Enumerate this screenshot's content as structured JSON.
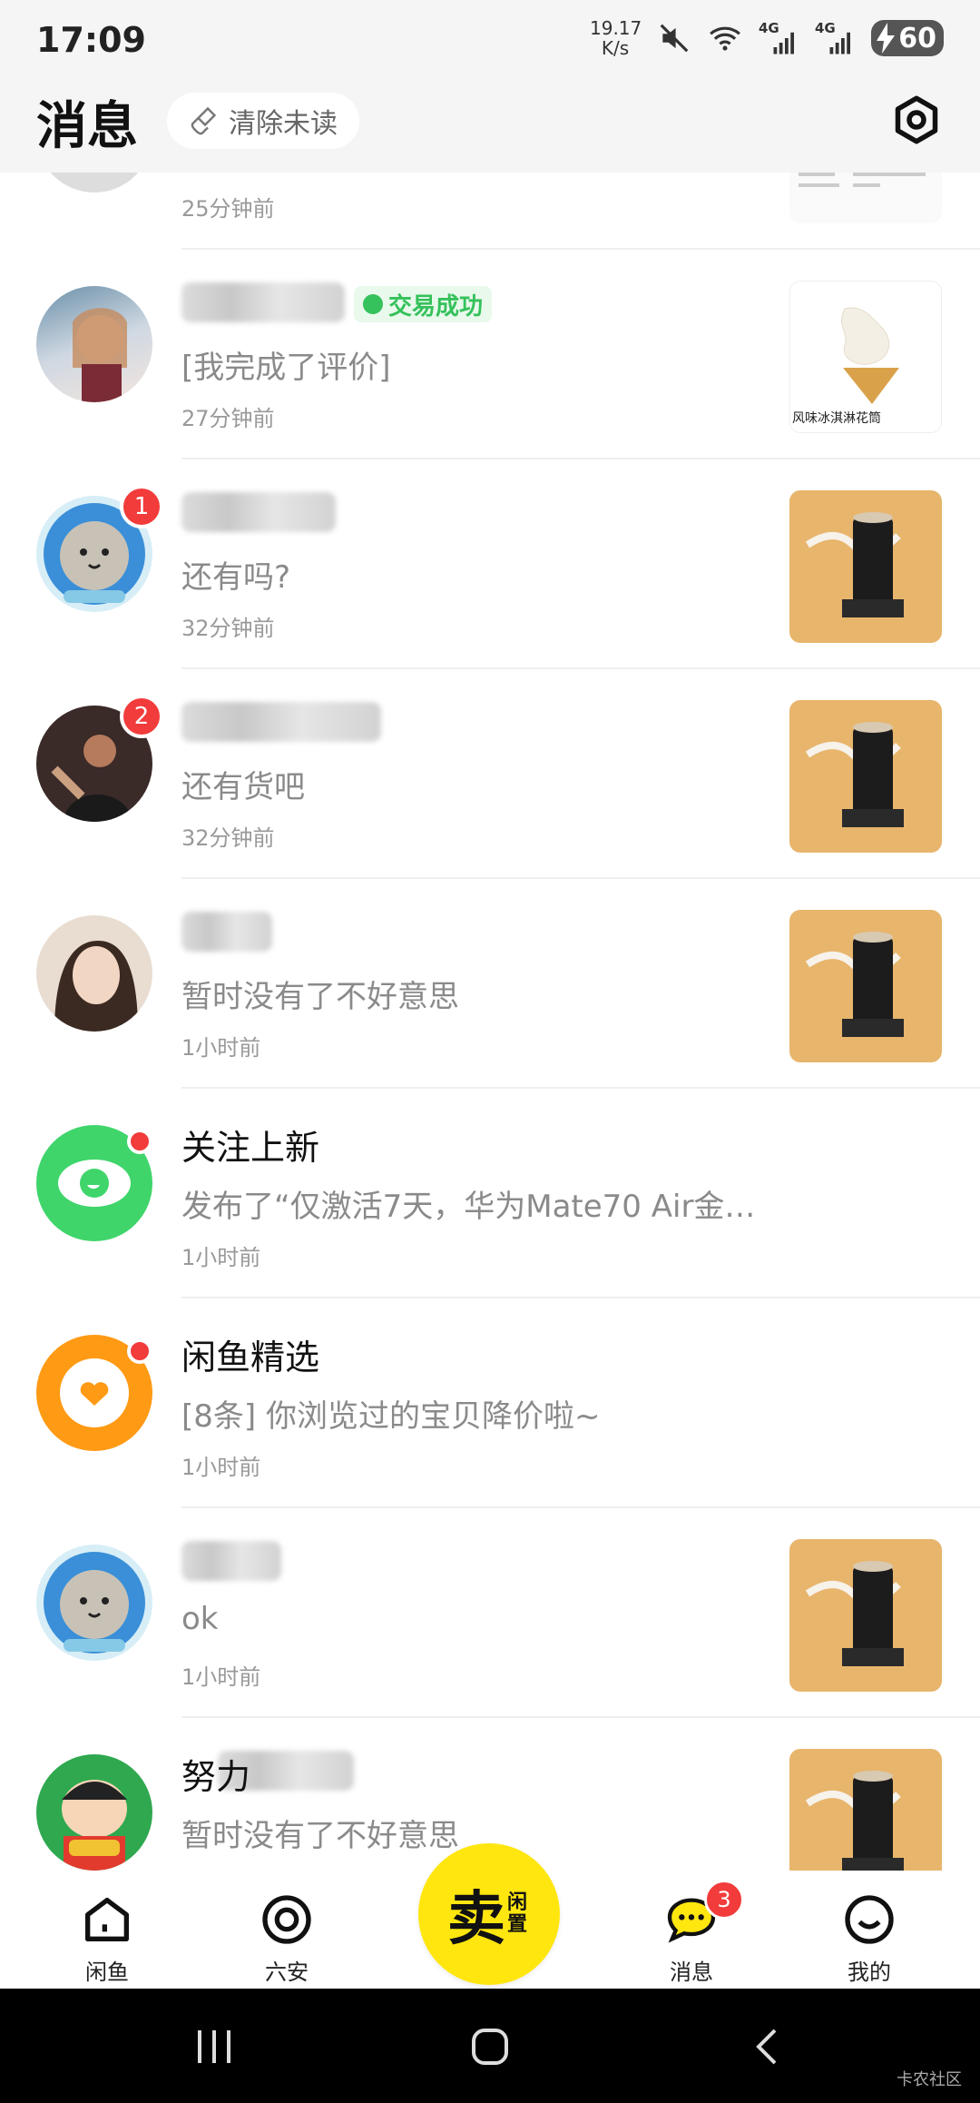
{
  "status_bar": {
    "time": "17:09",
    "net_speed_value": "19.17",
    "net_speed_unit": "K/s",
    "signal_1": "4G",
    "signal_2": "4G",
    "battery": "60"
  },
  "header": {
    "title": "消息",
    "clear_unread": "清除未读"
  },
  "conversations": [
    {
      "name": "",
      "message": "",
      "time": "25分钟前"
    },
    {
      "name": "",
      "tag": "交易成功",
      "message": "[我完成了评价]",
      "time": "27分钟前",
      "thumb_caption": "风味冰淇淋花筒"
    },
    {
      "name": "",
      "badge": "1",
      "message": "还有吗?",
      "time": "32分钟前"
    },
    {
      "name": "",
      "badge": "2",
      "message": "还有货吧",
      "time": "32分钟前"
    },
    {
      "name": "",
      "message": "暂时没有了不好意思",
      "time": "1小时前"
    },
    {
      "name": "关注上新",
      "message": "发布了“仅激活7天，华为Mate70 Air金…",
      "time": "1小时前"
    },
    {
      "name": "闲鱼精选",
      "message": "[8条] 你浏览过的宝贝降价啦~",
      "time": "1小时前"
    },
    {
      "name": "",
      "message": "ok",
      "time": "1小时前"
    },
    {
      "name": "努力",
      "message": "暂时没有了不好意思",
      "time": ""
    }
  ],
  "bottom_nav": {
    "home": "闲鱼",
    "local": "六安",
    "sell_main": "卖",
    "sell_sub": "闲置",
    "messages": "消息",
    "messages_badge": "3",
    "mine": "我的"
  },
  "watermark": "卡农社区",
  "colors": {
    "accent_yellow": "#ffe60f",
    "badge_red": "#f23b3b",
    "success_green": "#35c15b"
  }
}
